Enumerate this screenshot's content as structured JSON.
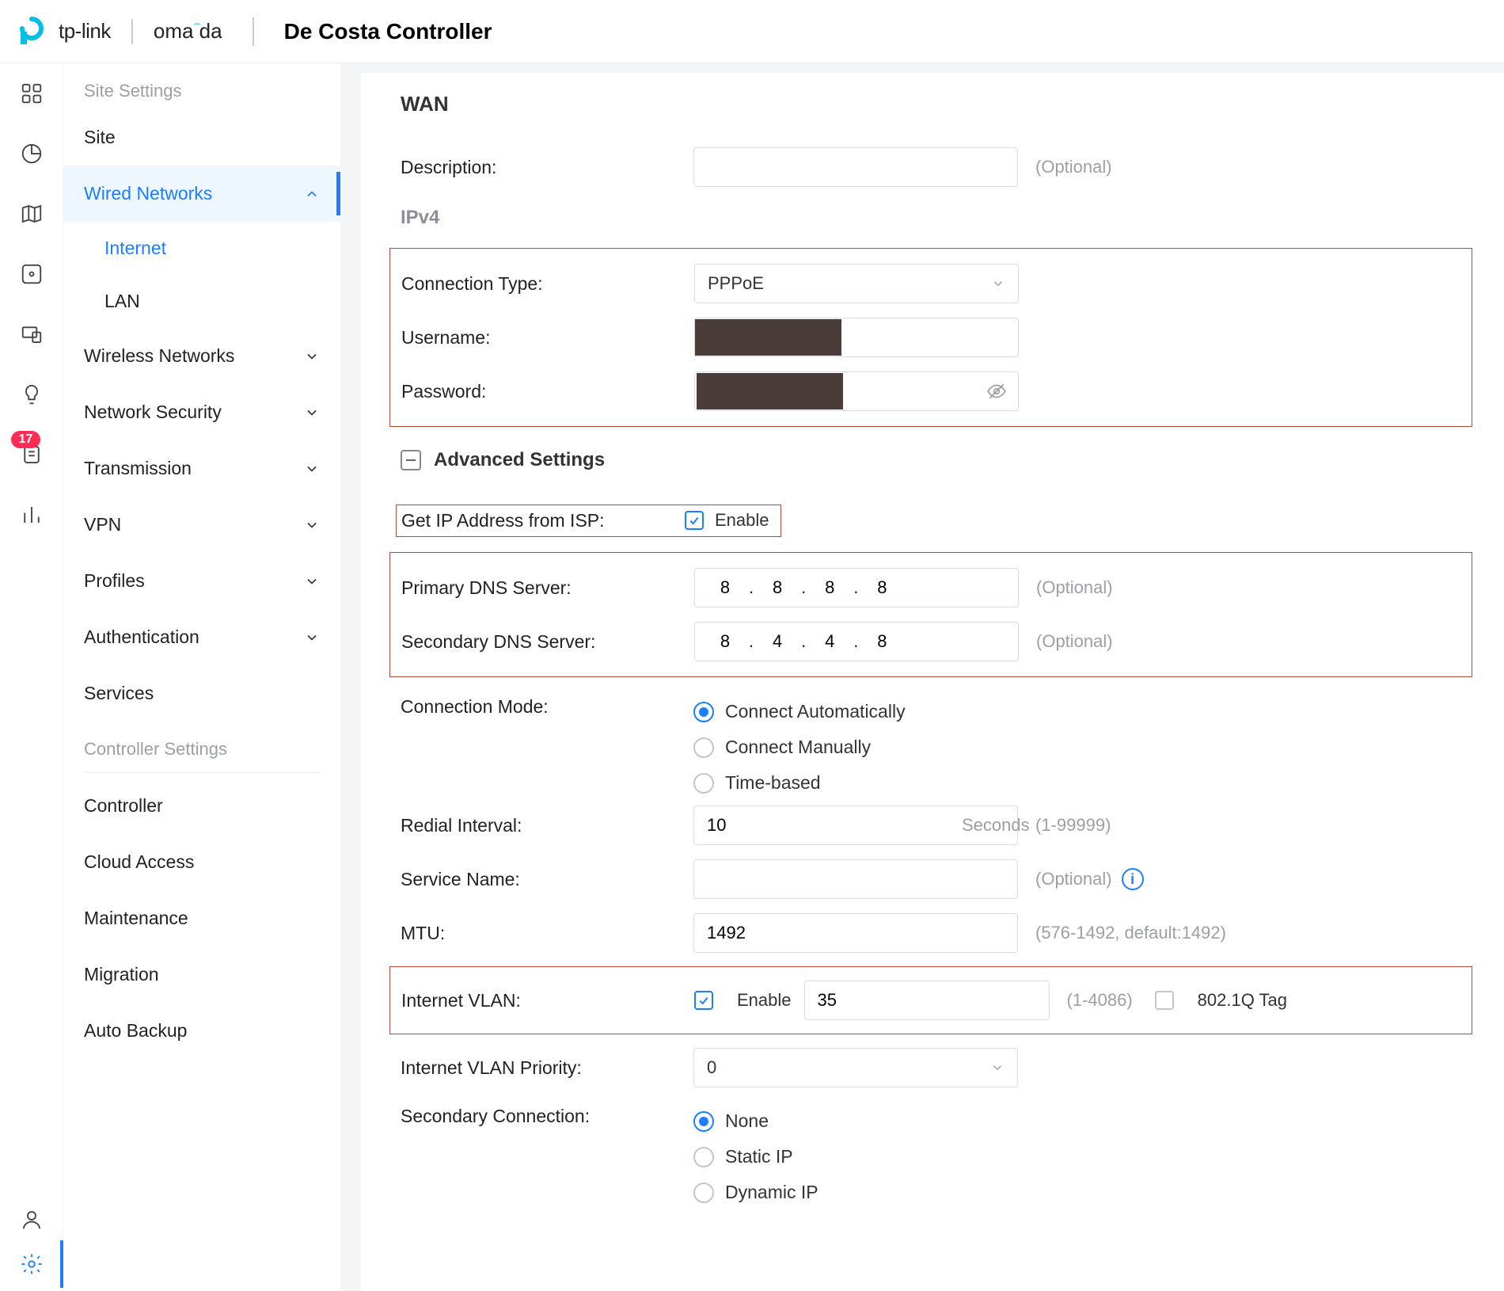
{
  "header": {
    "brand1": "tp-link",
    "brand2": "omada",
    "controller": "De Costa Controller"
  },
  "iconbar": {
    "badge": "17"
  },
  "sidebar": {
    "section1": "Site Settings",
    "site": "Site",
    "wired": "Wired Networks",
    "internet": "Internet",
    "lan": "LAN",
    "wireless": "Wireless Networks",
    "security": "Network Security",
    "transmission": "Transmission",
    "vpn": "VPN",
    "profiles": "Profiles",
    "auth": "Authentication",
    "services": "Services",
    "section2": "Controller Settings",
    "controller": "Controller",
    "cloud": "Cloud Access",
    "maint": "Maintenance",
    "migration": "Migration",
    "backup": "Auto Backup"
  },
  "wan": {
    "title": "WAN",
    "desc_label": "Description:",
    "desc_value": "",
    "optional": "(Optional)",
    "ipv4_header": "IPv4",
    "conn_type_label": "Connection Type:",
    "conn_type_value": "PPPoE",
    "user_label": "Username:",
    "pass_label": "Password:",
    "adv_header": "Advanced Settings",
    "isp_label": "Get IP Address from ISP:",
    "enable": "Enable",
    "pdns_label": "Primary DNS Server:",
    "pdns": [
      "8",
      "8",
      "8",
      "8"
    ],
    "sdns_label": "Secondary DNS Server:",
    "sdns": [
      "8",
      "4",
      "4",
      "8"
    ],
    "mode_label": "Connection Mode:",
    "mode_opts": [
      "Connect Automatically",
      "Connect Manually",
      "Time-based"
    ],
    "redial_label": "Redial Interval:",
    "redial_value": "10",
    "redial_unit": "Seconds",
    "redial_hint": "(1-99999)",
    "svc_label": "Service Name:",
    "svc_value": "",
    "mtu_label": "MTU:",
    "mtu_value": "1492",
    "mtu_hint": "(576-1492,  default:1492)",
    "vlan_label": "Internet VLAN:",
    "vlan_id": "35",
    "vlan_hint": "(1-4086)",
    "vlan_tag": "802.1Q Tag",
    "vlan_prio_label": "Internet VLAN Priority:",
    "vlan_prio_value": "0",
    "sec_label": "Secondary Connection:",
    "sec_opts": [
      "None",
      "Static IP",
      "Dynamic IP"
    ]
  }
}
